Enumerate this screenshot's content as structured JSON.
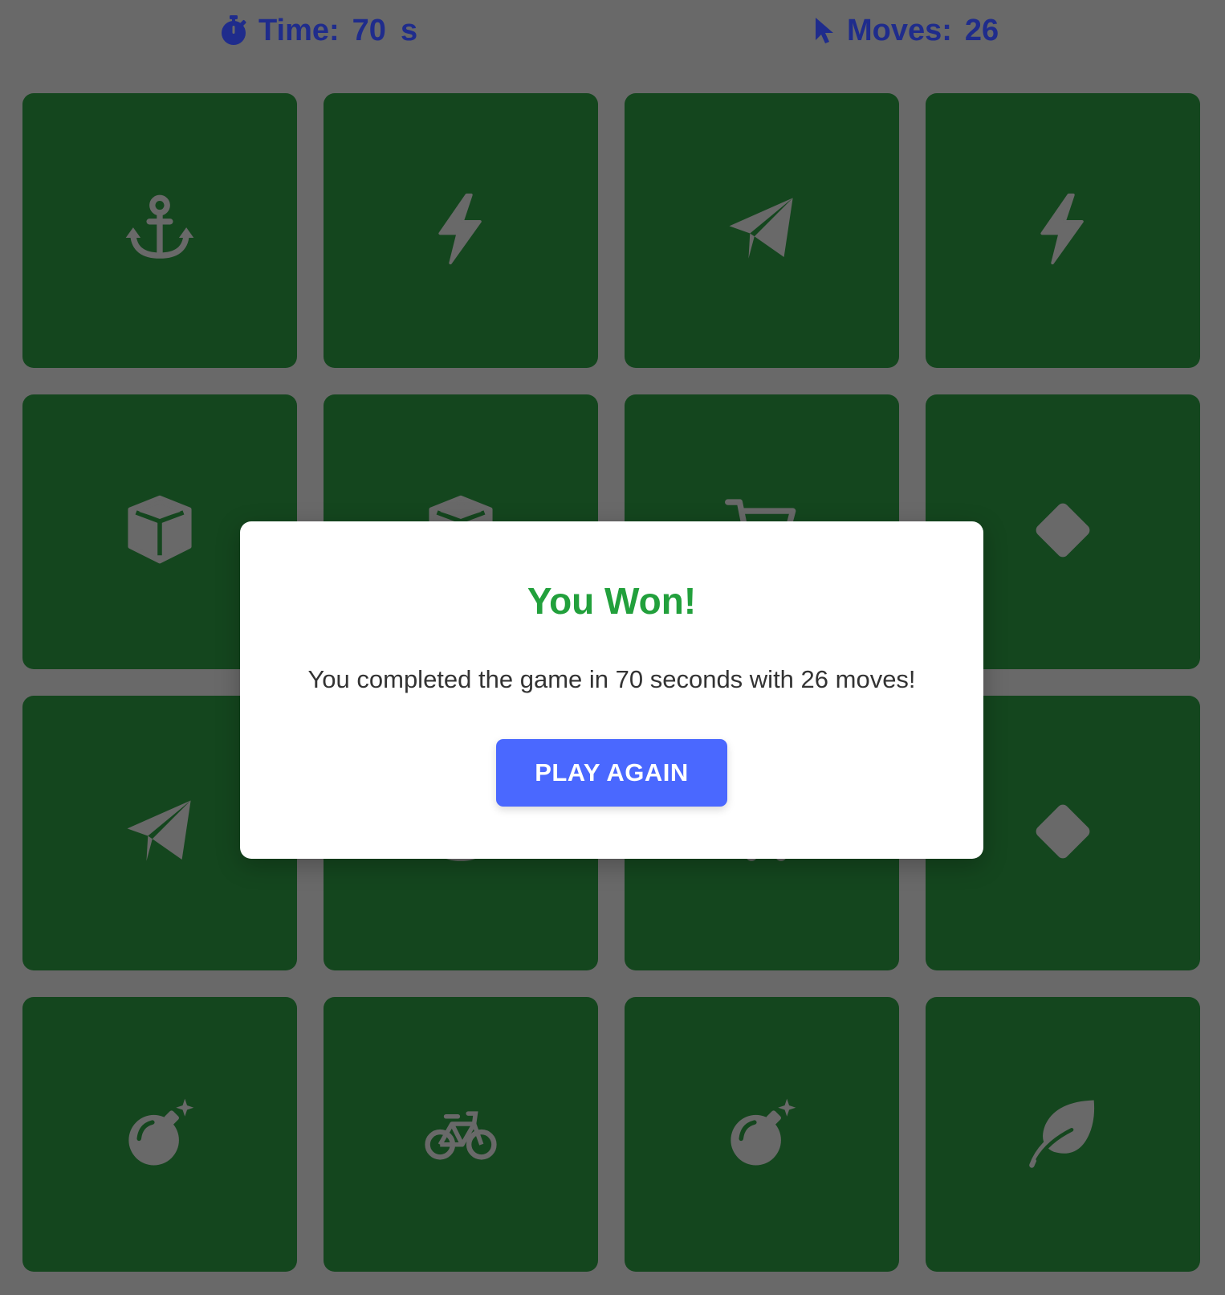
{
  "stats": {
    "time": {
      "label": "Time:",
      "value": "70",
      "unit": "s",
      "icon": "stopwatch-icon"
    },
    "moves": {
      "label": "Moves:",
      "value": "26",
      "icon": "cursor-icon"
    }
  },
  "board": {
    "rows": 4,
    "columns": 4,
    "cards": [
      {
        "icon": "anchor-icon"
      },
      {
        "icon": "bolt-icon"
      },
      {
        "icon": "paper-plane-icon"
      },
      {
        "icon": "bolt-icon"
      },
      {
        "icon": "cube-icon"
      },
      {
        "icon": "cube-icon"
      },
      {
        "icon": "cart-icon"
      },
      {
        "icon": "diamond-icon"
      },
      {
        "icon": "paper-plane-icon"
      },
      {
        "icon": "anchor-icon"
      },
      {
        "icon": "cart-icon"
      },
      {
        "icon": "diamond-icon"
      },
      {
        "icon": "bomb-icon"
      },
      {
        "icon": "bicycle-icon"
      },
      {
        "icon": "bomb-icon"
      },
      {
        "icon": "leaf-icon"
      }
    ]
  },
  "modal": {
    "title": "You Won!",
    "message": "You completed the game in 70 seconds with 26 moves!",
    "button_label": "PLAY AGAIN"
  },
  "colors": {
    "background_overlay": "#696969",
    "card": "#14461e",
    "icon": "#696969",
    "stats_text": "#1f2c8c",
    "title": "#22a03c",
    "button": "#4a68ff"
  }
}
